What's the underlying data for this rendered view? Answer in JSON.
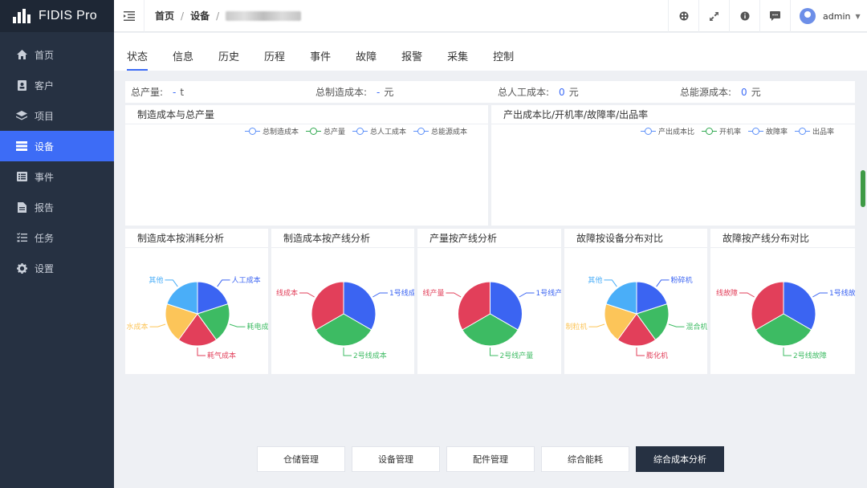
{
  "app": {
    "title": "FIDIS Pro"
  },
  "sidebar": {
    "items": [
      {
        "label": "首页",
        "icon": "home-icon",
        "active": false
      },
      {
        "label": "客户",
        "icon": "contact-book-icon",
        "active": false
      },
      {
        "label": "项目",
        "icon": "layers-icon",
        "active": false
      },
      {
        "label": "设备",
        "icon": "server-icon",
        "active": true
      },
      {
        "label": "事件",
        "icon": "list-icon",
        "active": false
      },
      {
        "label": "报告",
        "icon": "document-icon",
        "active": false
      },
      {
        "label": "任务",
        "icon": "tasks-icon",
        "active": false
      },
      {
        "label": "设置",
        "icon": "gear-icon",
        "active": false
      }
    ]
  },
  "header": {
    "breadcrumb": [
      "首页",
      "设备"
    ],
    "user": "admin"
  },
  "tabs": [
    "状态",
    "信息",
    "历史",
    "历程",
    "事件",
    "故障",
    "报警",
    "采集",
    "控制"
  ],
  "stats": [
    {
      "label": "总产量:",
      "value": "-",
      "unit": "t"
    },
    {
      "label": "总制造成本:",
      "value": "-",
      "unit": "元"
    },
    {
      "label": "总人工成本:",
      "value": "0",
      "unit": "元"
    },
    {
      "label": "总能源成本:",
      "value": "0",
      "unit": "元"
    }
  ],
  "panels": {
    "cost_output": {
      "title": "制造成本与总产量",
      "legend": [
        "总制造成本",
        "总产量",
        "总人工成本",
        "总能源成本"
      ]
    },
    "rates": {
      "title": "产出成本比/开机率/故障率/出品率",
      "legend": [
        "产出成本比",
        "开机率",
        "故障率",
        "出品率"
      ]
    }
  },
  "colors": {
    "accent": "#3d6cf6",
    "legend": [
      "#5b8ff9",
      "#2fa84f",
      "#5b8ff9",
      "#5b8ff9"
    ],
    "pie": {
      "blue": "#3b64f2",
      "green": "#3dbb63",
      "red": "#e23f5a",
      "yellow": "#fcc559",
      "sky": "#4aaef8"
    }
  },
  "chart_data": [
    {
      "type": "pie",
      "title": "制造成本按消耗分析",
      "slices": [
        {
          "label": "人工成本",
          "value": 20,
          "color": "blue"
        },
        {
          "label": "耗电成",
          "value": 20,
          "color": "green"
        },
        {
          "label": "耗气成本",
          "value": 20,
          "color": "red"
        },
        {
          "label": "水成本",
          "value": 20,
          "color": "yellow"
        },
        {
          "label": "其他",
          "value": 20,
          "color": "sky"
        }
      ]
    },
    {
      "type": "pie",
      "title": "制造成本按产线分析",
      "slices": [
        {
          "label": "1号线成",
          "value": 33.3,
          "color": "blue"
        },
        {
          "label": "2号线成本",
          "value": 33.3,
          "color": "green"
        },
        {
          "label": "线成本",
          "value": 33.3,
          "color": "red"
        }
      ]
    },
    {
      "type": "pie",
      "title": "产量按产线分析",
      "slices": [
        {
          "label": "1号线产",
          "value": 33.3,
          "color": "blue"
        },
        {
          "label": "2号线产量",
          "value": 33.3,
          "color": "green"
        },
        {
          "label": "线产量",
          "value": 33.3,
          "color": "red"
        }
      ]
    },
    {
      "type": "pie",
      "title": "故障按设备分布对比",
      "slices": [
        {
          "label": "粉碎机",
          "value": 20,
          "color": "blue"
        },
        {
          "label": "混合机",
          "value": 20,
          "color": "green"
        },
        {
          "label": "膨化机",
          "value": 20,
          "color": "red"
        },
        {
          "label": "制粒机",
          "value": 20,
          "color": "yellow"
        },
        {
          "label": "其他",
          "value": 20,
          "color": "sky"
        }
      ]
    },
    {
      "type": "pie",
      "title": "故障按产线分布对比",
      "slices": [
        {
          "label": "1号线故",
          "value": 33.3,
          "color": "blue"
        },
        {
          "label": "2号线故障",
          "value": 33.3,
          "color": "green"
        },
        {
          "label": "线故障",
          "value": 33.3,
          "color": "red"
        }
      ]
    }
  ],
  "bottom_buttons": [
    {
      "label": "仓储管理",
      "active": false
    },
    {
      "label": "设备管理",
      "active": false
    },
    {
      "label": "配件管理",
      "active": false
    },
    {
      "label": "综合能耗",
      "active": false
    },
    {
      "label": "综合成本分析",
      "active": true
    }
  ]
}
